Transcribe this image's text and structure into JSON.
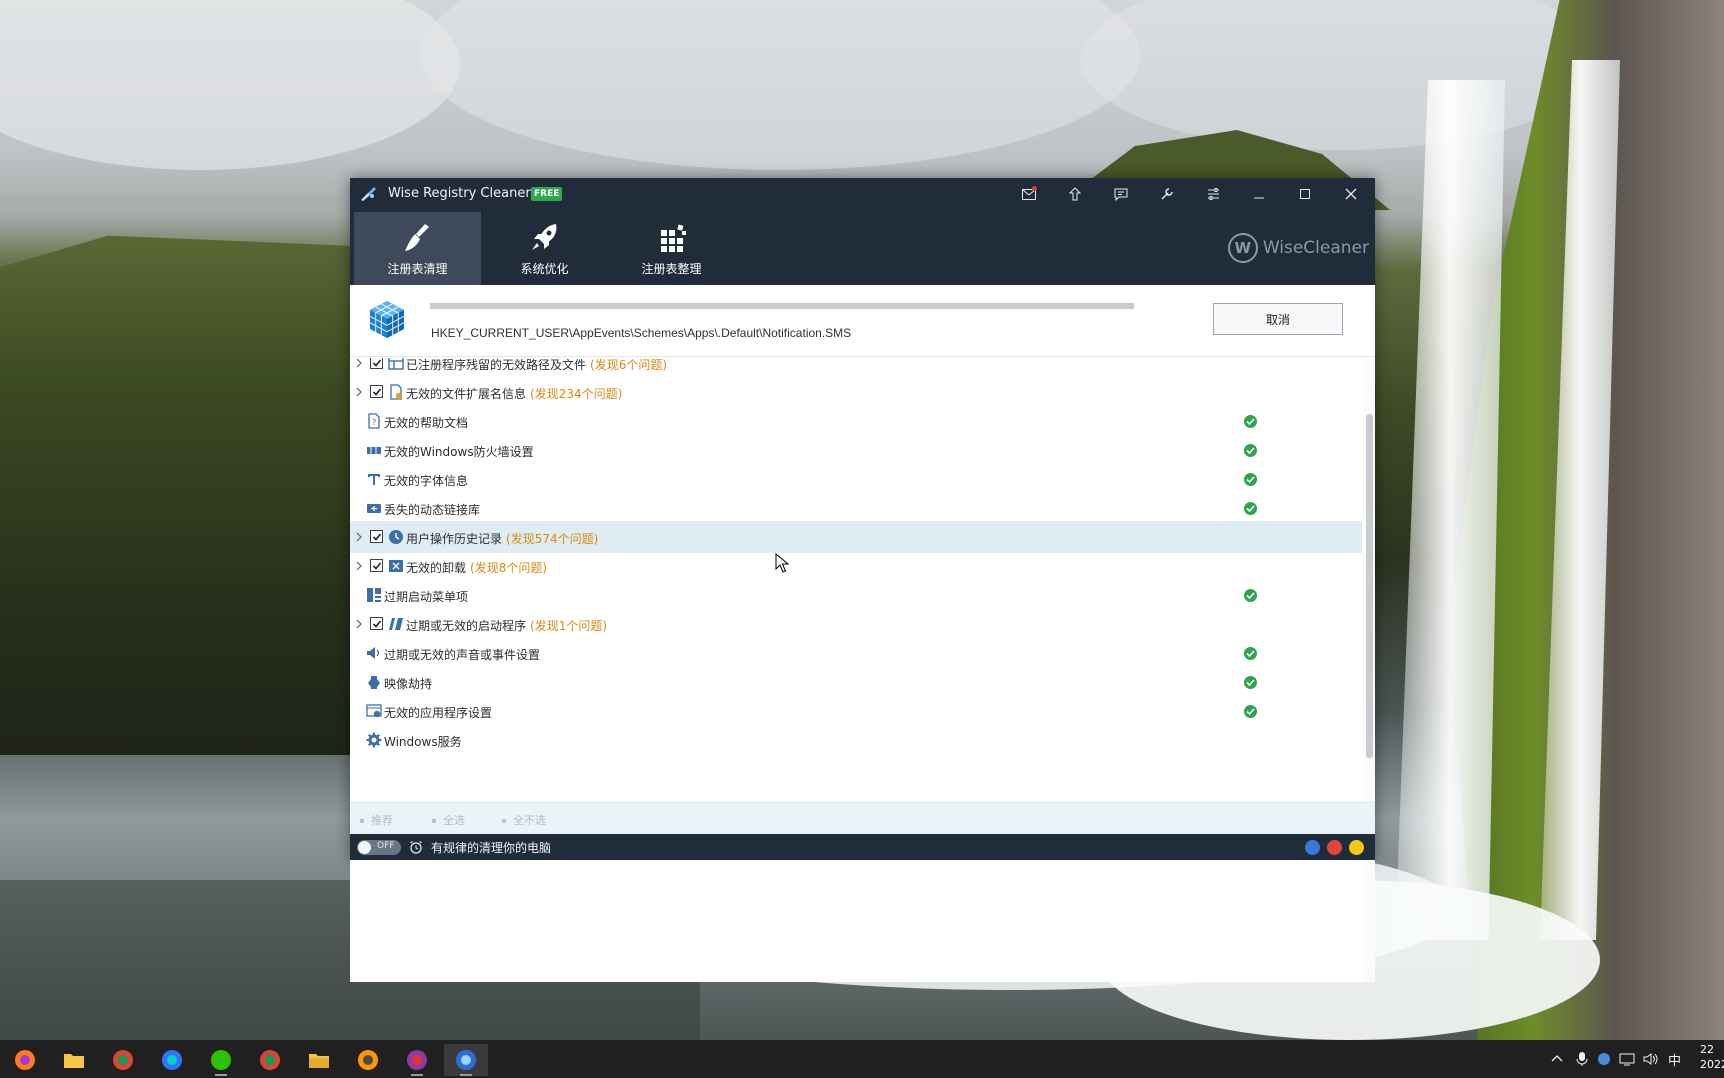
{
  "window": {
    "title": "Wise Registry Cleaner X",
    "edition_badge": "FREE",
    "title_buttons": [
      "mail-icon",
      "upgrade-icon",
      "feedback-icon",
      "tools-icon",
      "menu-icon",
      "minimize-icon",
      "maximize-icon",
      "close-icon"
    ]
  },
  "toolbar": {
    "tabs": [
      {
        "label": "注册表清理",
        "icon": "broom-icon",
        "active": true
      },
      {
        "label": "系统优化",
        "icon": "rocket-icon",
        "active": false
      },
      {
        "label": "注册表整理",
        "icon": "defrag-blocks-icon",
        "active": false
      }
    ],
    "brand": {
      "logo_letter": "W",
      "name": "WiseCleaner"
    }
  },
  "scan": {
    "progress": 1.0,
    "current_key": "HKEY_CURRENT_USER\\AppEvents\\Schemes\\Apps\\.Default\\Notification.SMS",
    "cancel_label": "取消"
  },
  "categories": [
    {
      "label": "已注册程序残留的无效路径及文件",
      "issues": "(发现6个问题)",
      "expandable": true,
      "checked": true,
      "ok": false
    },
    {
      "label": "无效的文件扩展名信息",
      "issues": "(发现234个问题)",
      "expandable": true,
      "checked": true,
      "ok": false
    },
    {
      "label": "无效的帮助文档",
      "issues": "",
      "expandable": false,
      "checked": false,
      "ok": true
    },
    {
      "label": "无效的Windows防火墙设置",
      "issues": "",
      "expandable": false,
      "checked": false,
      "ok": true
    },
    {
      "label": "无效的字体信息",
      "issues": "",
      "expandable": false,
      "checked": false,
      "ok": true
    },
    {
      "label": "丢失的动态链接库",
      "issues": "",
      "expandable": false,
      "checked": false,
      "ok": true
    },
    {
      "label": "用户操作历史记录",
      "issues": "(发现574个问题)",
      "expandable": true,
      "checked": true,
      "ok": false,
      "highlighted": true
    },
    {
      "label": "无效的卸载",
      "issues": "(发现8个问题)",
      "expandable": true,
      "checked": true,
      "ok": false
    },
    {
      "label": "过期启动菜单项",
      "issues": "",
      "expandable": false,
      "checked": false,
      "ok": true
    },
    {
      "label": "过期或无效的启动程序",
      "issues": "(发现1个问题)",
      "expandable": true,
      "checked": true,
      "ok": false
    },
    {
      "label": "过期或无效的声音或事件设置",
      "issues": "",
      "expandable": false,
      "checked": false,
      "ok": true
    },
    {
      "label": "映像劫持",
      "issues": "",
      "expandable": false,
      "checked": false,
      "ok": true
    },
    {
      "label": "无效的应用程序设置",
      "issues": "",
      "expandable": false,
      "checked": false,
      "ok": true
    },
    {
      "label": "Windows服务",
      "issues": "",
      "expandable": false,
      "checked": false,
      "ok": false
    }
  ],
  "selection": {
    "recommended": "推荐",
    "select_all": "全选",
    "select_none": "全不选"
  },
  "status": {
    "toggle_state": "OFF",
    "schedule_label": "有规律的清理你的电脑"
  },
  "taskbar": {
    "apps": [
      "firefox-icon",
      "file-explorer-icon",
      "chrome-icon",
      "feishu-icon",
      "wechat-icon",
      "chrome-icon",
      "folder-icon",
      "sublime-text-icon",
      "winrar-icon",
      "wise-registry-cleaner-icon"
    ],
    "ime": "中",
    "clock_time": "22",
    "clock_date": "2022"
  }
}
